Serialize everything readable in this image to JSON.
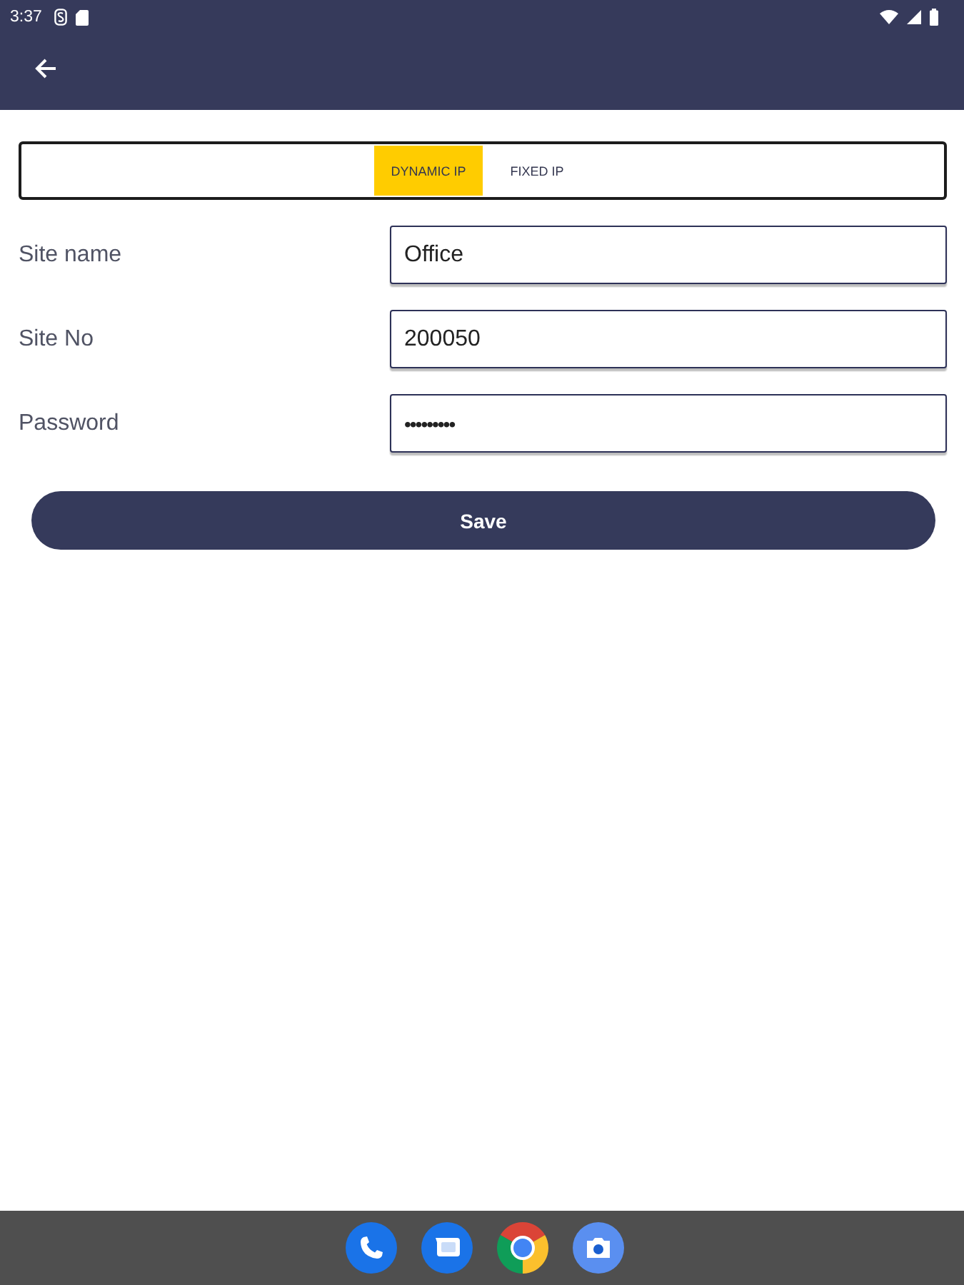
{
  "status_bar": {
    "time": "3:37"
  },
  "mode_tabs": [
    {
      "label": "DYNAMIC IP",
      "selected": true
    },
    {
      "label": "FIXED IP",
      "selected": false
    }
  ],
  "fields": [
    {
      "kind": "text",
      "label": "Site name",
      "value": "Office"
    },
    {
      "kind": "text",
      "label": "Site No",
      "value": "200050"
    },
    {
      "kind": "password",
      "label": "Password",
      "value": "•••••••••"
    }
  ],
  "save_button": {
    "label": "Save"
  }
}
